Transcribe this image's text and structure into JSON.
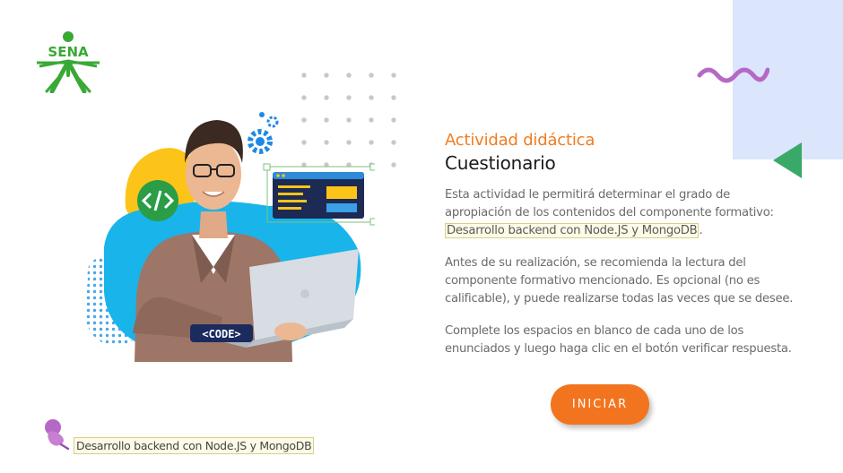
{
  "logo": {
    "text": "SENA"
  },
  "illustration": {
    "badge_text": "<CODE>"
  },
  "activity": {
    "kicker": "Actividad didáctica",
    "title": "Cuestionario",
    "p1_text": "Esta actividad le permitirá determinar el grado de apropiación de los contenidos del componente formativo: ",
    "component_name": "Desarrollo backend con Node.JS y MongoDB",
    "p1_end": ".",
    "p2": "Antes de su realización, se recomienda la lectura del componente formativo mencionado.  Es opcional (no es calificable), y puede realizarse todas las veces que se desee.",
    "p3": "Complete los espacios en blanco de cada uno de los enunciados y luego haga clic en el botón verificar respuesta."
  },
  "start_button": {
    "label": "INICIAR"
  },
  "footer": {
    "component_name": "Desarrollo backend con Node.JS y MongoDB"
  },
  "colors": {
    "accent_orange": "#f2741f",
    "sena_green": "#39a935",
    "panel_blue": "#dbe5fb",
    "wave_purple": "#b668c6",
    "highlight_bg": "#fdfbe7"
  }
}
